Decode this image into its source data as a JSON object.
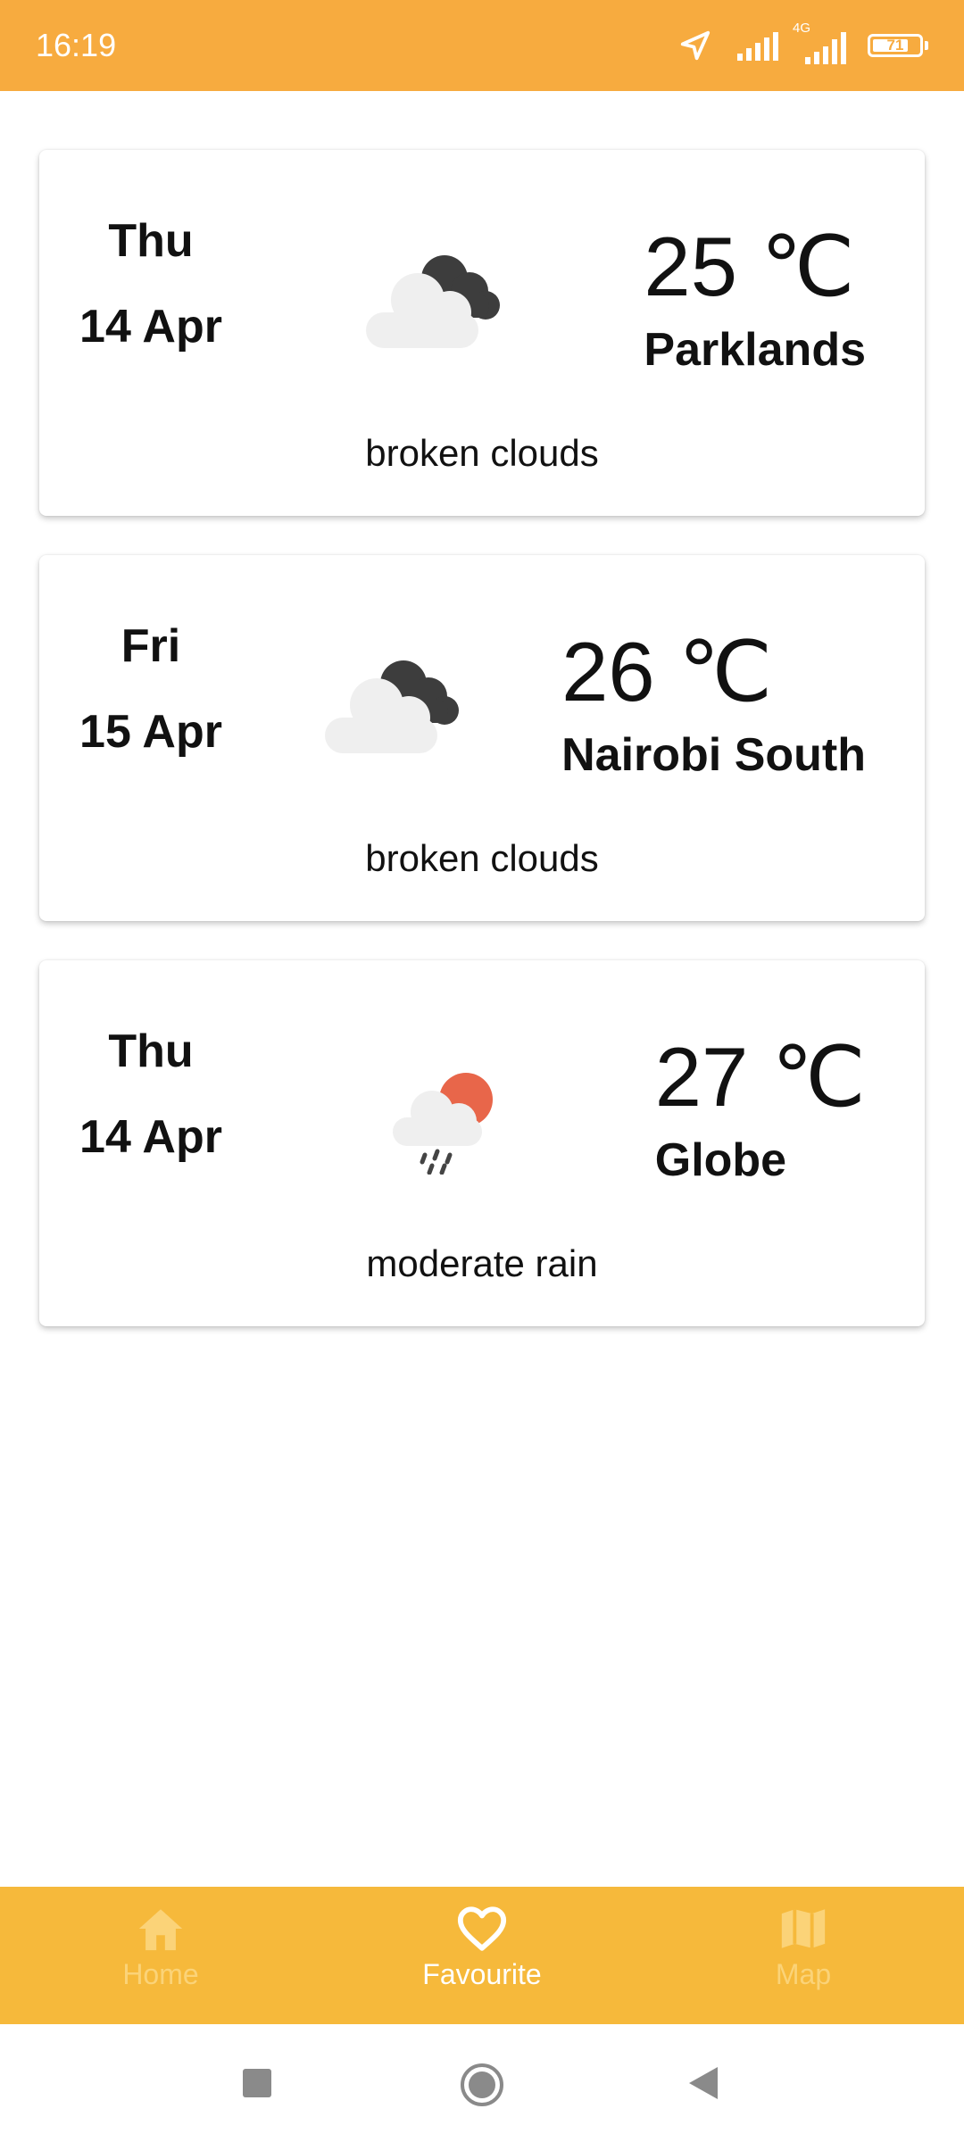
{
  "status_bar": {
    "time": "16:19",
    "network_type": "4G",
    "battery_level": "71",
    "background": "#f7ab3f"
  },
  "cards": [
    {
      "day": "Thu",
      "date": "14 Apr",
      "icon": "broken-clouds-icon",
      "temperature": "25 ℃",
      "location": "Parklands",
      "description": "broken clouds"
    },
    {
      "day": "Fri",
      "date": "15 Apr",
      "icon": "broken-clouds-icon",
      "temperature": "26 ℃",
      "location": "Nairobi South",
      "description": "broken clouds"
    },
    {
      "day": "Thu",
      "date": "14 Apr",
      "icon": "moderate-rain-icon",
      "temperature": "27 ℃",
      "location": "Globe",
      "description": "moderate rain"
    }
  ],
  "bottom_nav": {
    "items": [
      {
        "label": "Home",
        "icon": "home-icon",
        "active": false
      },
      {
        "label": "Favourite",
        "icon": "heart-icon",
        "active": true
      },
      {
        "label": "Map",
        "icon": "map-icon",
        "active": false
      }
    ],
    "background": "#f6b93b",
    "active_color": "#ffffff",
    "inactive_color": "#fbd378"
  },
  "system_nav": {
    "buttons": [
      "recents-square-icon",
      "home-circle-icon",
      "back-triangle-icon"
    ]
  }
}
